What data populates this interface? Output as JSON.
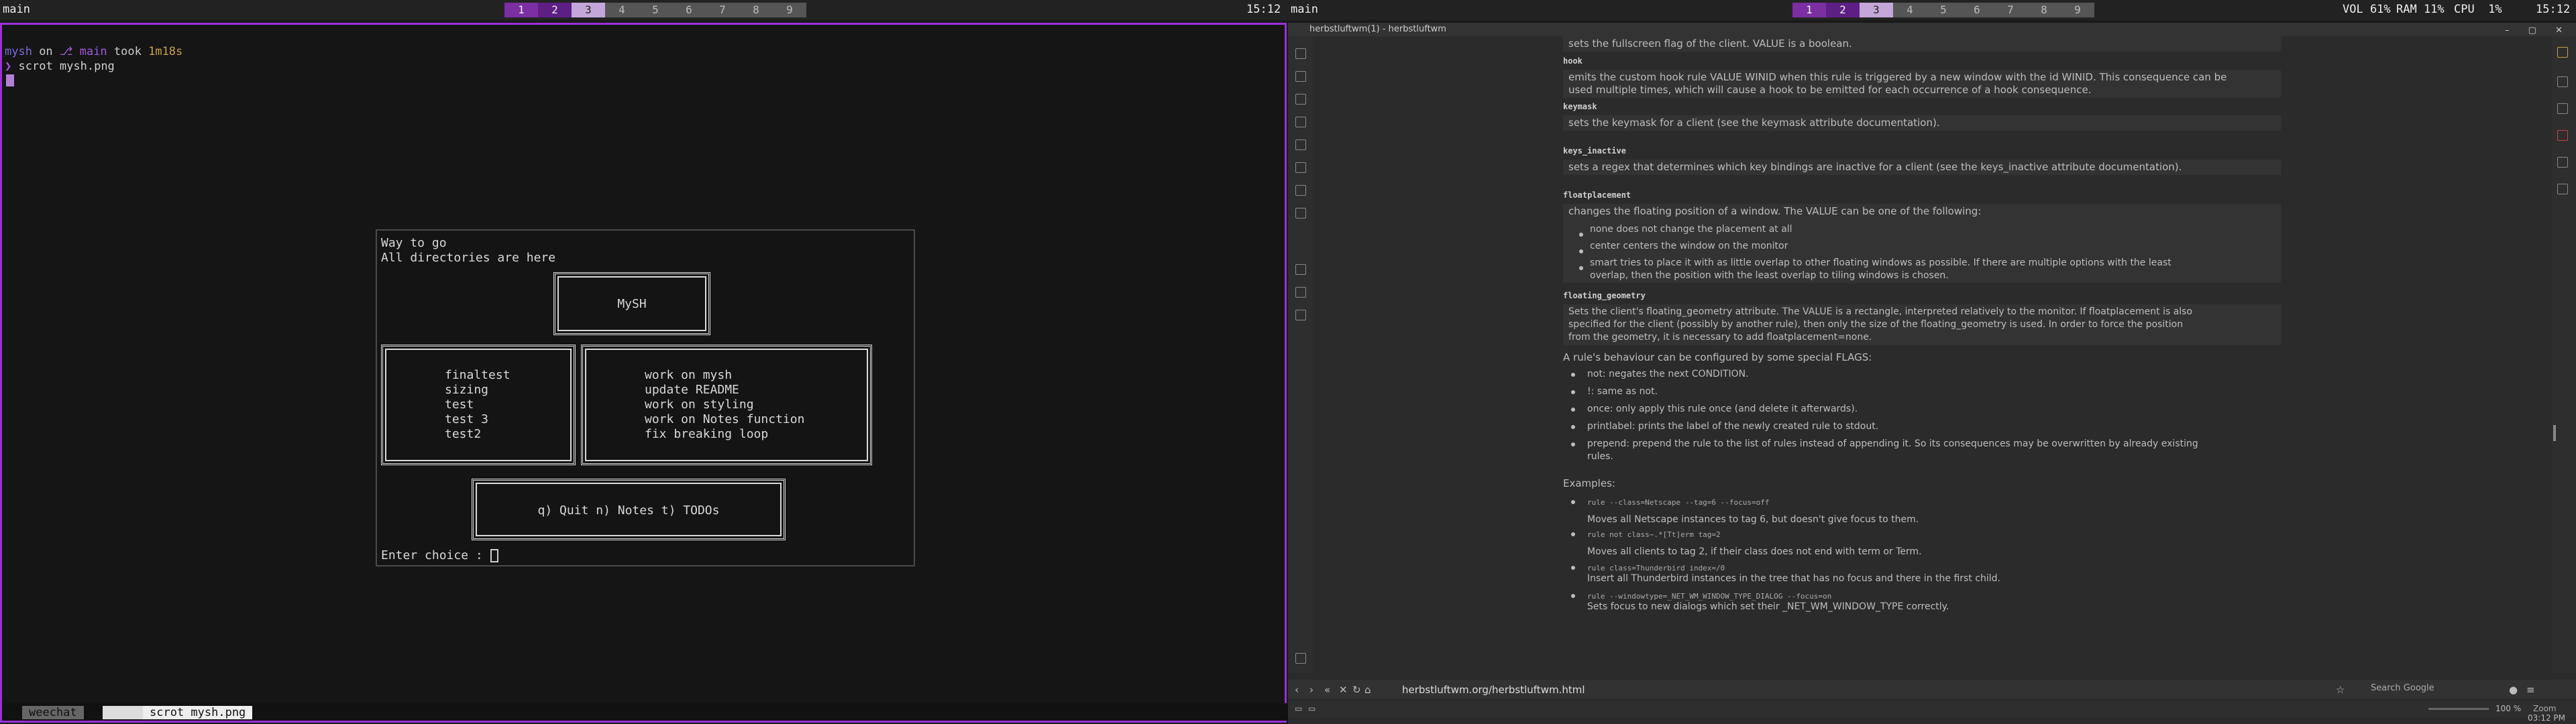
{
  "topbar": {
    "left": {
      "title": "main",
      "tags": [
        "1",
        "2",
        "3",
        "4",
        "5",
        "6",
        "7",
        "8",
        "9"
      ],
      "clock": "15:12"
    },
    "right": {
      "title": "main",
      "tags": [
        "1",
        "2",
        "3",
        "4",
        "5",
        "6",
        "7",
        "8",
        "9"
      ],
      "vol": "VOL 61%",
      "ram": "RAM 11%",
      "cpu": "CPU  1%",
      "clock": "15:12"
    }
  },
  "terminal": {
    "prompt_dir": "mysh",
    "prompt_on": " on ",
    "prompt_branch": "⎇ main",
    "prompt_took": " took ",
    "prompt_time": "1m18s",
    "prompt_symbol": "❯",
    "command": "scrot mysh.png"
  },
  "mysh": {
    "line1": "Way to go",
    "line2": "All directories are here",
    "title": "MySH",
    "dirs": [
      "finaltest",
      "sizing",
      "test",
      "test 3",
      "test2"
    ],
    "todos": [
      "work on mysh",
      "update README",
      "work on styling",
      "work on Notes function",
      "fix breaking loop"
    ],
    "menu": "q) Quit n) Notes t) TODOs",
    "choice_label": "Enter choice :"
  },
  "statusbar": {
    "tab1": "weechat",
    "tab2": "scrot mysh.png"
  },
  "browser": {
    "window_title": "herbstluftwm(1) - herbstluftwm",
    "url": "herbstluftwm.org/herbstluftwm.html",
    "search_placeholder": "Search Google",
    "zoom_label": "Zoom",
    "zoom": "100 %",
    "time": "03:12 PM",
    "doc": {
      "fullscreen_text": "sets the fullscreen flag of the client. VALUE is a boolean.",
      "hook_head": "hook",
      "hook_text1": "emits the custom hook rule VALUE WINID when this rule is triggered by a new window with the id WINID. This consequence can be",
      "hook_text2": "used multiple times, which will cause a hook to be emitted for each occurrence of a hook consequence.",
      "keymask_head": "keymask",
      "keymask_text": "sets the keymask for a client (see the keymask attribute documentation).",
      "keys_inactive_head": "keys_inactive",
      "keys_inactive_text": "sets a regex that determines which key bindings are inactive for a client (see the keys_inactive attribute documentation).",
      "floatplacement_head": "floatplacement",
      "floatplacement_text": "changes the floating position of a window. The VALUE can be one of the following:",
      "fp_none": "none does not change the placement at all",
      "fp_center": "center centers the window on the monitor",
      "fp_smart1": "smart tries to place it with as little overlap to other floating windows as possible. If there are multiple options with the least",
      "fp_smart2": "overlap, then the position with the least overlap to tiling windows is chosen.",
      "floating_geometry_head": "floating_geometry",
      "fg_text1": "Sets the client's floating_geometry attribute. The VALUE is a rectangle, interpreted relatively to the monitor. If floatplacement is also",
      "fg_text2": "specified for the client (possibly by another rule), then only the size of the floating_geometry is used. In order to force the position",
      "fg_text3": "from the geometry, it is necessary to add floatplacement=none.",
      "flags_intro": "A rule's behaviour can be configured by some special FLAGS:",
      "flag_not": "not: negates the next CONDITION.",
      "flag_bang": "!: same as not.",
      "flag_once": "once: only apply this rule once (and delete it afterwards).",
      "flag_printlabel": "printlabel: prints the label of the newly created rule to stdout.",
      "flag_prepend1": "prepend: prepend the rule to the list of rules instead of appending it. So its consequences may be overwritten by already existing",
      "flag_prepend2": "rules.",
      "examples_head": "Examples:",
      "ex1_code": "rule --class=Netscape --tag=6 --focus=off",
      "ex1_text": "Moves all Netscape instances to tag 6, but doesn't give focus to them.",
      "ex2_code": "rule not class~.*[Tt]erm tag=2",
      "ex2_text": "Moves all clients to tag 2, if their class does not end with term or Term.",
      "ex3_code": "rule class=Thunderbird index=/0",
      "ex3_text": "Insert all Thunderbird instances in the tree that has no focus and there in the first child.",
      "ex4_code": "rule --windowtype=_NET_WM_WINDOW_TYPE_DIALOG --focus=on",
      "ex4_text": "Sets focus to new dialogs which set their _NET_WM_WINDOW_TYPE correctly."
    }
  },
  "colors": {
    "accent": "#9b30d9",
    "tag_focus": "#c4a7d8",
    "prompt_dir": "#7a6bd8",
    "prompt_branch": "#a05ad8"
  }
}
